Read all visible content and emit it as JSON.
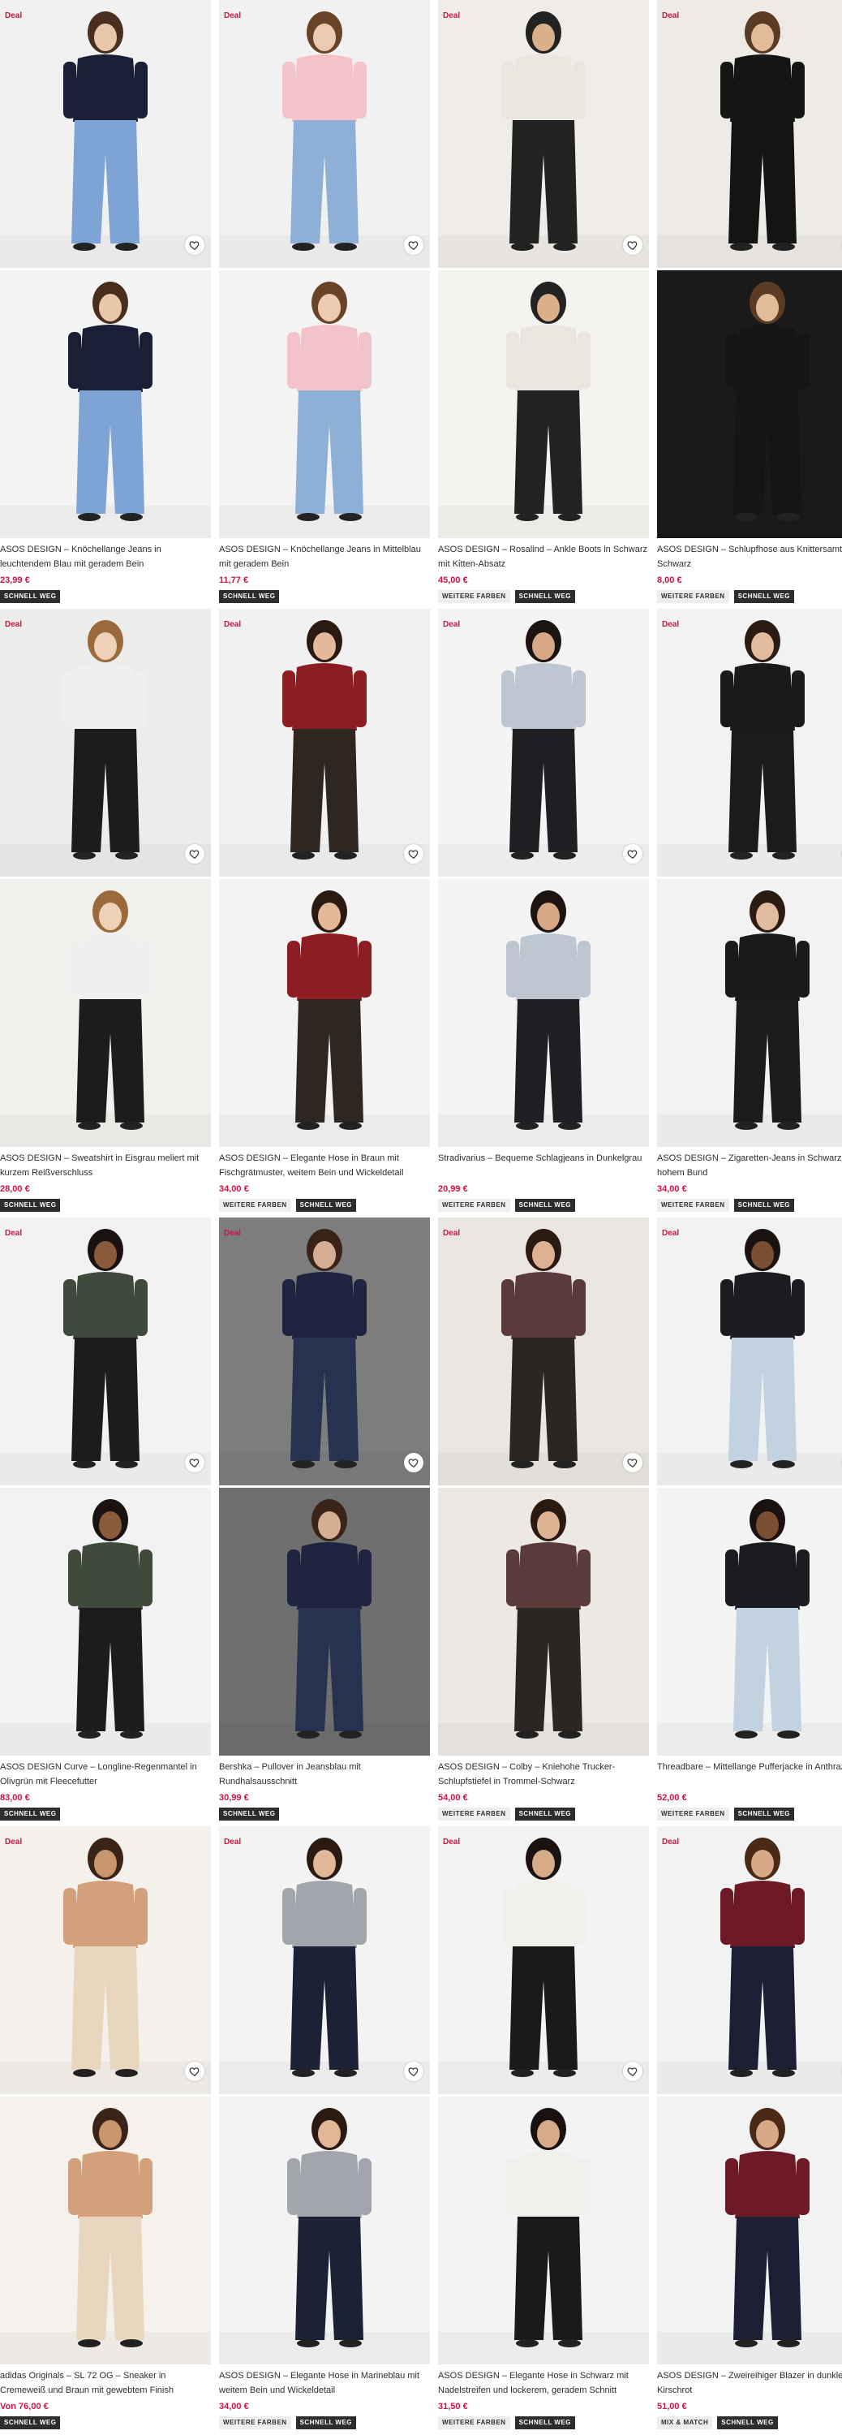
{
  "colors": {
    "deal": "#d01345",
    "price": "#d01345",
    "badge_dark": "#2d2d2d",
    "badge_light": "#eeeeee"
  },
  "icons": {
    "favorite": "heart-icon"
  },
  "products": [
    {
      "deal": "Deal",
      "title": "ASOS DESIGN – Knöchellange Jeans in leuchtendem Blau mit geradem Bein",
      "price": "23,99 €",
      "badges": [
        "SCHNELL WEG"
      ],
      "top": "#1b1f36",
      "bottom": "#7ea4d6",
      "bg1": "#f1f1f1",
      "bg2": "#f3f3f3",
      "skin": "#e9c7aa",
      "hair": "#4a2f1f"
    },
    {
      "deal": "Deal",
      "title": "ASOS DESIGN – Knöchellange Jeans in Mittelblau mit geradem Bein",
      "price": "11,77 €",
      "badges": [
        "SCHNELL WEG"
      ],
      "top": "#f2c4ca",
      "bottom": "#8fb0d6",
      "bg1": "#f1f1f1",
      "bg2": "#f3f3f3",
      "skin": "#eccbb0",
      "hair": "#6a4228"
    },
    {
      "deal": "Deal",
      "title": "ASOS DESIGN – Rosalind – Ankle Boots in Schwarz mit Kitten-Absatz",
      "price": "45,00 €",
      "badges": [
        "WEITERE FARBEN",
        "SCHNELL WEG"
      ],
      "top": "#e9e6e0",
      "bottom": "#222222",
      "bg1": "#f0ede8",
      "bg2": "#f5f3ef",
      "skin": "#d9b08a",
      "hair": "#222222"
    },
    {
      "deal": "Deal",
      "title": "ASOS DESIGN – Schlupfhose aus Knittersamt in Schwarz",
      "price": "8,00 €",
      "badges": [
        "WEITERE FARBEN",
        "SCHNELL WEG"
      ],
      "top": "#151515",
      "bottom": "#141414",
      "bg1": "#eeebe6",
      "bg2": "#1a1a1a",
      "skin": "#e2bb9a",
      "hair": "#5b3b24"
    },
    {
      "deal": "Deal",
      "title": "ASOS DESIGN – Sweatshirt in Eisgrau meliert mit kurzem Reißverschluss",
      "price": "28,00 €",
      "badges": [
        "SCHNELL WEG"
      ],
      "top": "#f0efed",
      "bottom": "#1c1c1c",
      "bg1": "#ececea",
      "bg2": "#f2f0ec",
      "skin": "#efd1b8",
      "hair": "#9a6a3c"
    },
    {
      "deal": "Deal",
      "title": "ASOS DESIGN – Elegante Hose in Braun mit Fischgrätmuster, weitem Bein und Wickeldetail",
      "price": "34,00 €",
      "badges": [
        "WEITERE FARBEN",
        "SCHNELL WEG"
      ],
      "top": "#8e1c23",
      "bottom": "#2e2620",
      "bg1": "#f1f1f1",
      "bg2": "#f3f3f3",
      "skin": "#e3b99a",
      "hair": "#2a1a12"
    },
    {
      "deal": "Deal",
      "title": "Stradivarius – Bequeme Schlagjeans in Dunkelgrau",
      "price": "20,99 €",
      "badges": [
        "WEITERE FARBEN",
        "SCHNELL WEG"
      ],
      "top": "#bcc7d2",
      "bottom": "#1e1f22",
      "bg1": "#f4f4f4",
      "bg2": "#f4f4f4",
      "skin": "#d8a886",
      "hair": "#1b1410"
    },
    {
      "deal": "Deal",
      "title": "ASOS DESIGN – Zigaretten-Jeans in Schwarz mit hohem Bund",
      "price": "34,00 €",
      "badges": [
        "WEITERE FARBEN",
        "SCHNELL WEG"
      ],
      "top": "#1a1a1a",
      "bottom": "#1b1b1d",
      "bg1": "#f2f2f2",
      "bg2": "#f2f2f2",
      "skin": "#e2bc9e",
      "hair": "#2b1b12"
    },
    {
      "deal": "Deal",
      "title": "ASOS DESIGN Curve – Longline-Regenmantel in Olivgrün mit Fleecefutter",
      "price": "83,00 €",
      "badges": [
        "SCHNELL WEG"
      ],
      "top": "#3f4a3a",
      "bottom": "#1c1c1c",
      "bg1": "#f2f2f2",
      "bg2": "#f2f2f2",
      "skin": "#8a5a3c",
      "hair": "#1a1210"
    },
    {
      "deal": "Deal",
      "title": "Bershka – Pullover in Jeansblau mit Rundhalsausschnitt",
      "price": "30,99 €",
      "badges": [
        "SCHNELL WEG"
      ],
      "top": "#1f2540",
      "bottom": "#26324f",
      "bg1": "#7d7d7d",
      "bg2": "#6f6f6f",
      "skin": "#d4ad92",
      "hair": "#3a2418"
    },
    {
      "deal": "Deal",
      "title": "ASOS DESIGN – Colby – Kniehohe Trucker-Schlupfstiefel in Trommel-Schwarz",
      "price": "54,00 €",
      "badges": [
        "WEITERE FARBEN",
        "SCHNELL WEG"
      ],
      "top": "#5b3a3a",
      "bottom": "#2b2623",
      "bg1": "#eae6e1",
      "bg2": "#ece8e3",
      "skin": "#dcb293",
      "hair": "#2a1a12"
    },
    {
      "deal": "Deal",
      "title": "Threadbare – Mittellange Pufferjacke in Anthrazit",
      "price": "52,00 €",
      "badges": [
        "WEITERE FARBEN",
        "SCHNELL WEG"
      ],
      "top": "#1b1c20",
      "bottom": "#c2d2e0",
      "bg1": "#f2f2f2",
      "bg2": "#f4f4f4",
      "skin": "#7a4e33",
      "hair": "#191210"
    },
    {
      "deal": "Deal",
      "title": "adidas Originals – SL 72 OG – Sneaker in Cremeweiß und Braun mit gewebtem Finish",
      "price": "76,00 €",
      "price_prefix": "Von",
      "badges": [
        "SCHNELL WEG"
      ],
      "top": "#d2a17b",
      "bottom": "#e8d6bf",
      "bg1": "#f4f1ec",
      "bg2": "#f5f2ed",
      "skin": "#c9956d",
      "hair": "#3a2418"
    },
    {
      "deal": "Deal",
      "title": "ASOS DESIGN – Elegante Hose in Marineblau mit weitem Bein und Wickeldetail",
      "price": "34,00 €",
      "badges": [
        "WEITERE FARBEN",
        "SCHNELL WEG"
      ],
      "top": "#a2a5ac",
      "bottom": "#1c2235",
      "bg1": "#f3f3f3",
      "bg2": "#f3f3f3",
      "skin": "#e0b797",
      "hair": "#2a1a12"
    },
    {
      "deal": "Deal",
      "title": "ASOS DESIGN – Elegante Hose in Schwarz mit Nadelstreifen und lockerem, geradem Schnitt",
      "price": "31,50 €",
      "badges": [
        "WEITERE FARBEN",
        "SCHNELL WEG"
      ],
      "top": "#f2f0ec",
      "bottom": "#1a1a1a",
      "bg1": "#f3f3f3",
      "bg2": "#f3f3f3",
      "skin": "#d7ab8a",
      "hair": "#1a1210"
    },
    {
      "deal": "Deal",
      "title": "ASOS DESIGN – Zweireihiger Blazer in dunklem Kirschrot",
      "price": "51,00 €",
      "badges": [
        "MIX & MATCH",
        "SCHNELL WEG"
      ],
      "top": "#6e1a26",
      "bottom": "#1c1f33",
      "bg1": "#f2f2f2",
      "bg2": "#f2f2f2",
      "skin": "#d8a986",
      "hair": "#4a2a16"
    }
  ]
}
